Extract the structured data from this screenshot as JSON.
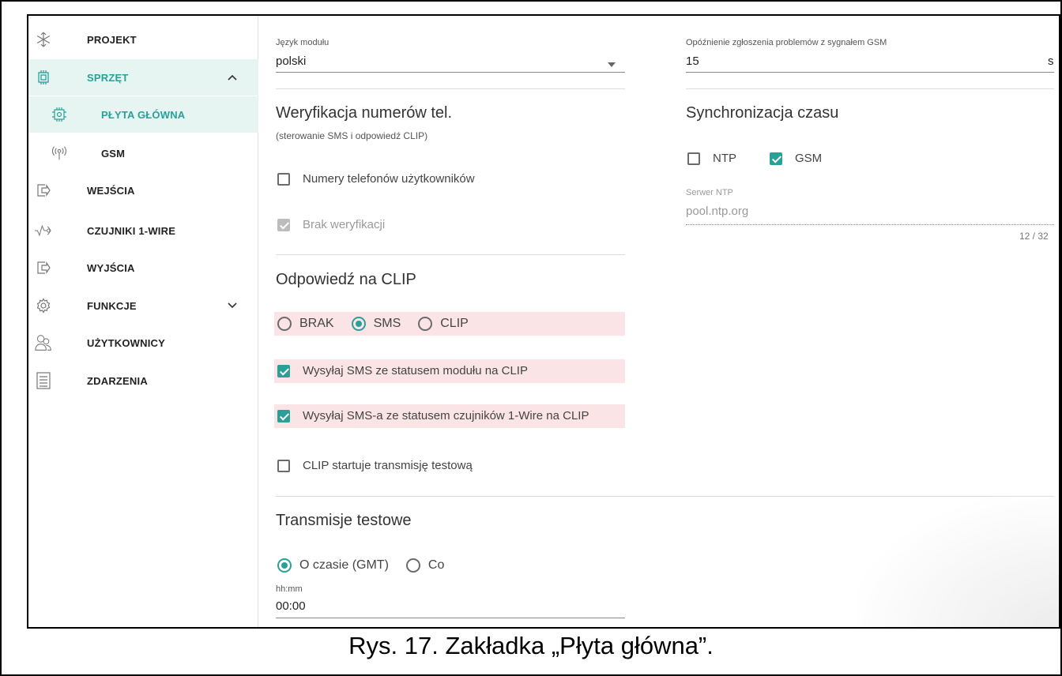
{
  "sidebar": {
    "items": [
      {
        "label": "PROJEKT",
        "icon": "snowflake-logo-icon"
      },
      {
        "label": "SPRZĘT",
        "icon": "chip-icon",
        "expanded": true
      },
      {
        "label": "PŁYTA GŁÓWNA",
        "icon": "chip-gear-icon"
      },
      {
        "label": "GSM",
        "icon": "antenna-icon"
      },
      {
        "label": "WEJŚCIA",
        "icon": "input-icon"
      },
      {
        "label": "CZUJNIKI 1-WIRE",
        "icon": "sensor-wave-icon"
      },
      {
        "label": "WYJŚCIA",
        "icon": "output-icon"
      },
      {
        "label": "FUNKCJE",
        "icon": "gear-icon",
        "expanded": false
      },
      {
        "label": "UŻYTKOWNICY",
        "icon": "users-icon"
      },
      {
        "label": "ZDARZENIA",
        "icon": "document-icon"
      }
    ]
  },
  "main": {
    "language": {
      "label": "Język modułu",
      "value": "polski"
    },
    "gsm_delay": {
      "label": "Opóźnienie zgłoszenia problemów z sygnałem GSM",
      "value": "15",
      "unit": "s"
    },
    "verification": {
      "title": "Weryfikacja numerów tel.",
      "note": "(sterowanie SMS i odpowiedź CLIP)",
      "user_numbers": {
        "label": "Numery telefonów użytkowników",
        "checked": false
      },
      "no_verification": {
        "label": "Brak weryfikacji",
        "checked": true
      }
    },
    "clip": {
      "title": "Odpowiedź na CLIP",
      "options": [
        "BRAK",
        "SMS",
        "CLIP"
      ],
      "selected": "SMS",
      "send_module_status": {
        "label": "Wysyłaj SMS ze statusem modułu na CLIP",
        "checked": true
      },
      "send_sensor_status": {
        "label": "Wysyłaj SMS-a ze statusem czujników 1-Wire na CLIP",
        "checked": true
      },
      "clip_test": {
        "label": "CLIP startuje transmisję testową",
        "checked": false
      }
    },
    "time_sync": {
      "title": "Synchronizacja czasu",
      "ntp": {
        "label": "NTP",
        "checked": false
      },
      "gsm": {
        "label": "GSM",
        "checked": true
      },
      "ntp_server": {
        "label": "Serwer NTP",
        "value": "pool.ntp.org",
        "counter": "12 / 32"
      }
    },
    "test_transmissions": {
      "title": "Transmisje testowe",
      "options": [
        "O czasie (GMT)",
        "Co"
      ],
      "selected": "O czasie (GMT)",
      "time": {
        "label": "hh:mm",
        "value": "00:00"
      }
    }
  },
  "caption": "Rys. 17. Zakładka „Płyta główna”.",
  "colors": {
    "accent": "#2aa198",
    "highlight": "#fbe4e6",
    "active_bg": "#e6f4f2"
  }
}
